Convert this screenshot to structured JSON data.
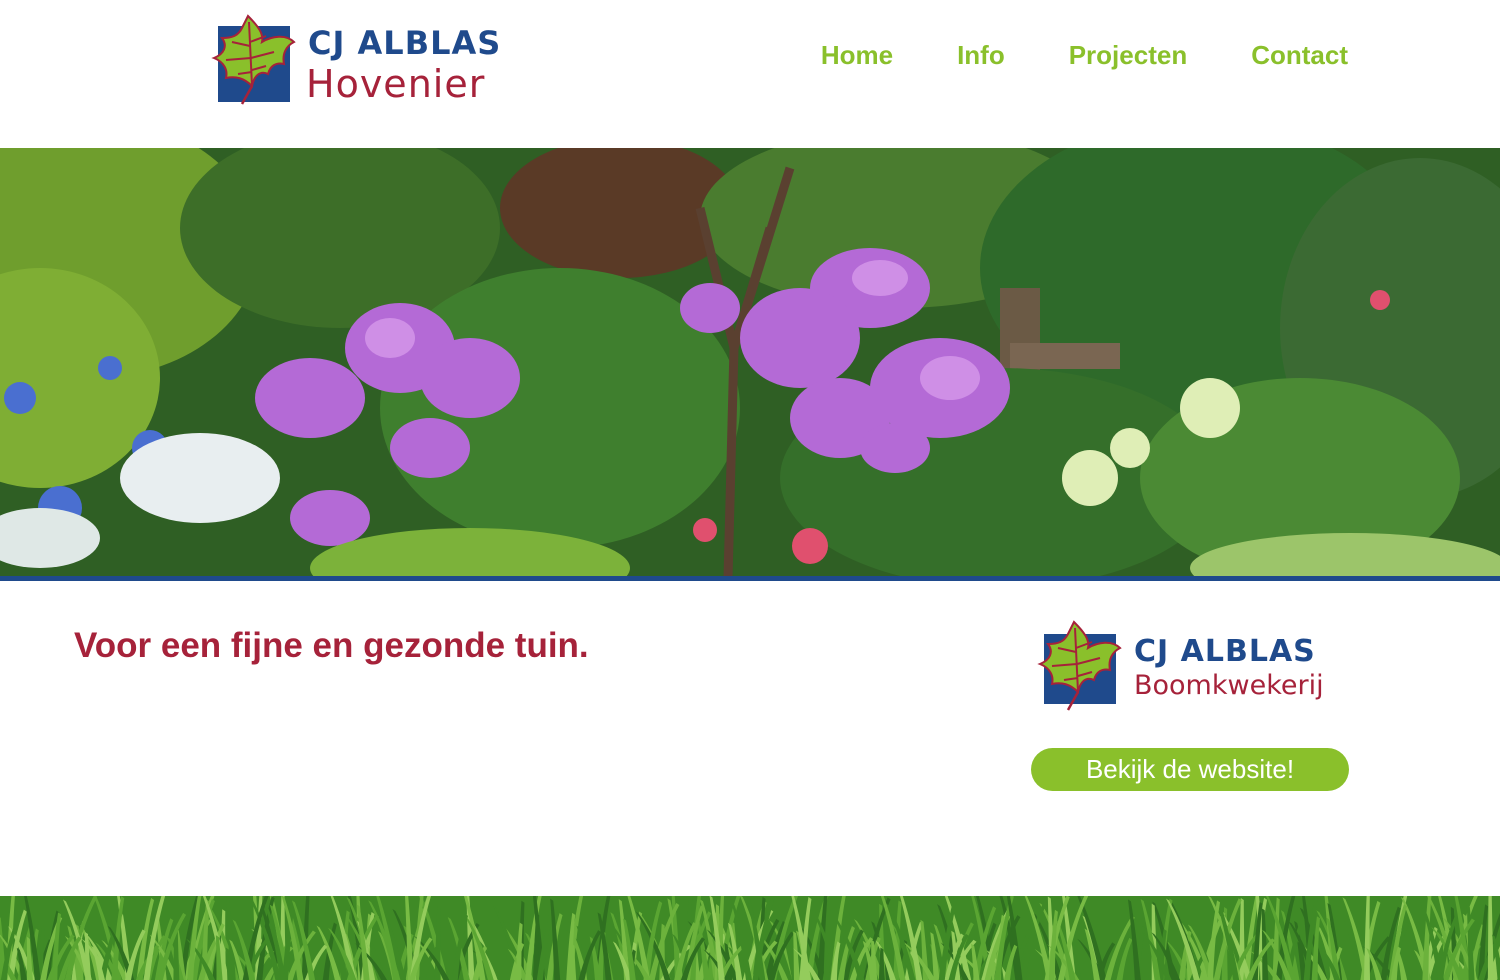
{
  "header": {
    "logo": {
      "line1": "CJ ALBLAS",
      "line2": "Hovenier",
      "icon": "leaf-logo-icon",
      "colors": {
        "blue": "#1f4a8c",
        "red": "#a6223a",
        "leaf": "#8ac02b"
      }
    },
    "nav": [
      {
        "label": "Home"
      },
      {
        "label": "Info"
      },
      {
        "label": "Projecten"
      },
      {
        "label": "Contact"
      }
    ]
  },
  "hero": {
    "image": "garden-flowers-photo",
    "accent_rule_color": "#1f4a8c"
  },
  "main": {
    "tagline": "Voor een fijne en gezonde tuin.",
    "partner_logo": {
      "line1": "CJ ALBLAS",
      "line2": "Boomkwekerij",
      "icon": "leaf-logo-icon"
    },
    "cta_label": "Bekijk de website!"
  },
  "footer": {
    "image": "grass-photo"
  },
  "colors": {
    "nav_green": "#8ac02b",
    "tagline_red": "#a6223a",
    "button_green": "#8ac02b"
  }
}
